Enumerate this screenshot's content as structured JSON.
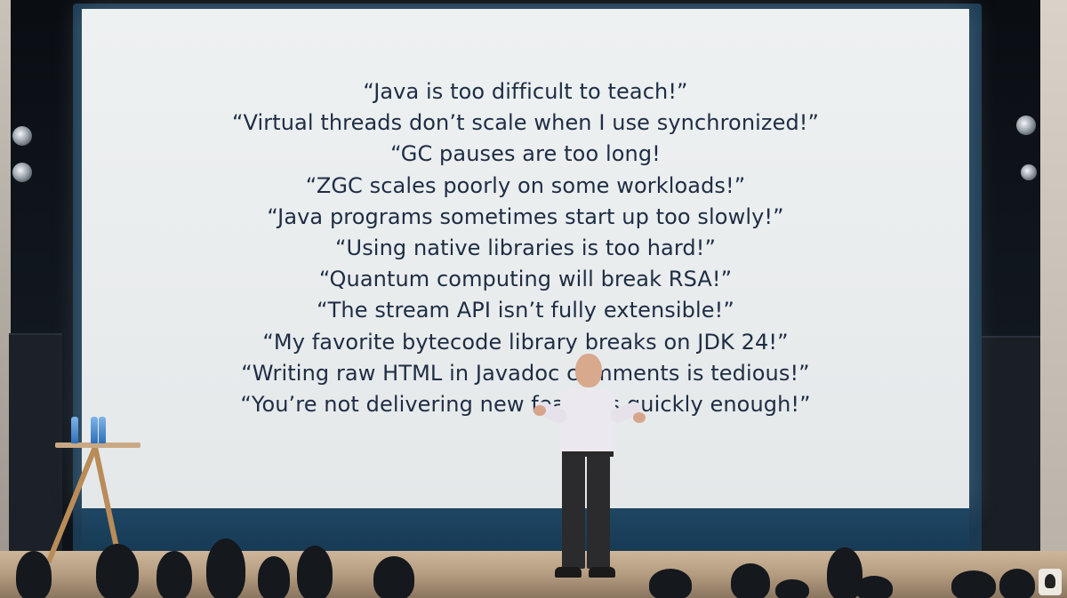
{
  "slide": {
    "quotes": [
      "“Java is too difficult to teach!”",
      "“Virtual threads don’t scale when I use synchronized!”",
      "“GC pauses are too long!",
      "“ZGC scales poorly on some workloads!”",
      "“Java programs sometimes start up too slowly!”",
      "“Using native libraries is too hard!”",
      "“Quantum computing will break RSA!”",
      "“The stream API isn’t fully extensible!”",
      "“My favorite bytecode library breaks on JDK 24!”",
      "“Writing raw HTML in Javadoc comments is tedious!”",
      "“You’re not delivering new features quickly enough!”"
    ]
  },
  "colors": {
    "slide_background": "#eceff0",
    "quote_text": "#1e2d44",
    "screen_frame": "#1b3a52",
    "floor": "#b49c80"
  },
  "scene": {
    "props": [
      "stage-light-icon",
      "water-bottle-icon",
      "side-table",
      "speaker",
      "audience"
    ]
  }
}
